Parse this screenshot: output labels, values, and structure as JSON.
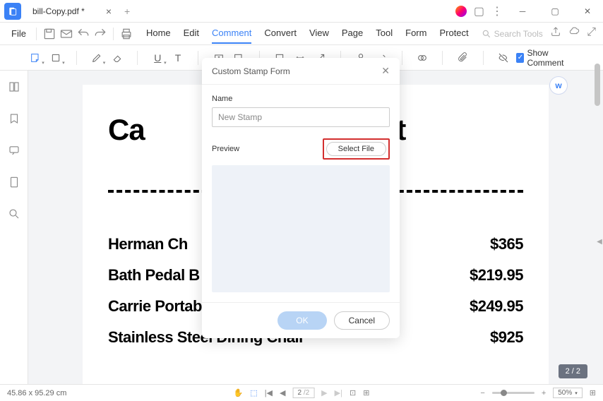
{
  "tab": {
    "title": "bill-Copy.pdf *"
  },
  "menu": {
    "file": "File",
    "items": [
      "Home",
      "Edit",
      "Comment",
      "Convert",
      "View",
      "Page",
      "Tool",
      "Form",
      "Protect"
    ],
    "active_index": 2,
    "search_placeholder": "Search Tools"
  },
  "toolbar": {
    "show_comment": "Show Comment"
  },
  "document": {
    "title_left": "Ca",
    "title_right": "List",
    "rows": [
      {
        "name": "Herman Ch",
        "price": "$365"
      },
      {
        "name": "Bath Pedal B",
        "price": "$219.95"
      },
      {
        "name": "Carrie Portable LED Lamp",
        "price": "$249.95"
      },
      {
        "name": "Stainless Steel Dining Chair",
        "price": "$925"
      }
    ]
  },
  "dialog": {
    "title": "Custom Stamp Form",
    "name_label": "Name",
    "name_value": "New Stamp",
    "preview_label": "Preview",
    "select_file": "Select File",
    "ok": "OK",
    "cancel": "Cancel"
  },
  "status": {
    "coords": "45.86 x 95.29 cm",
    "page": "2",
    "page_total": "/2",
    "zoom": "50%"
  },
  "page_badge": "2 / 2"
}
